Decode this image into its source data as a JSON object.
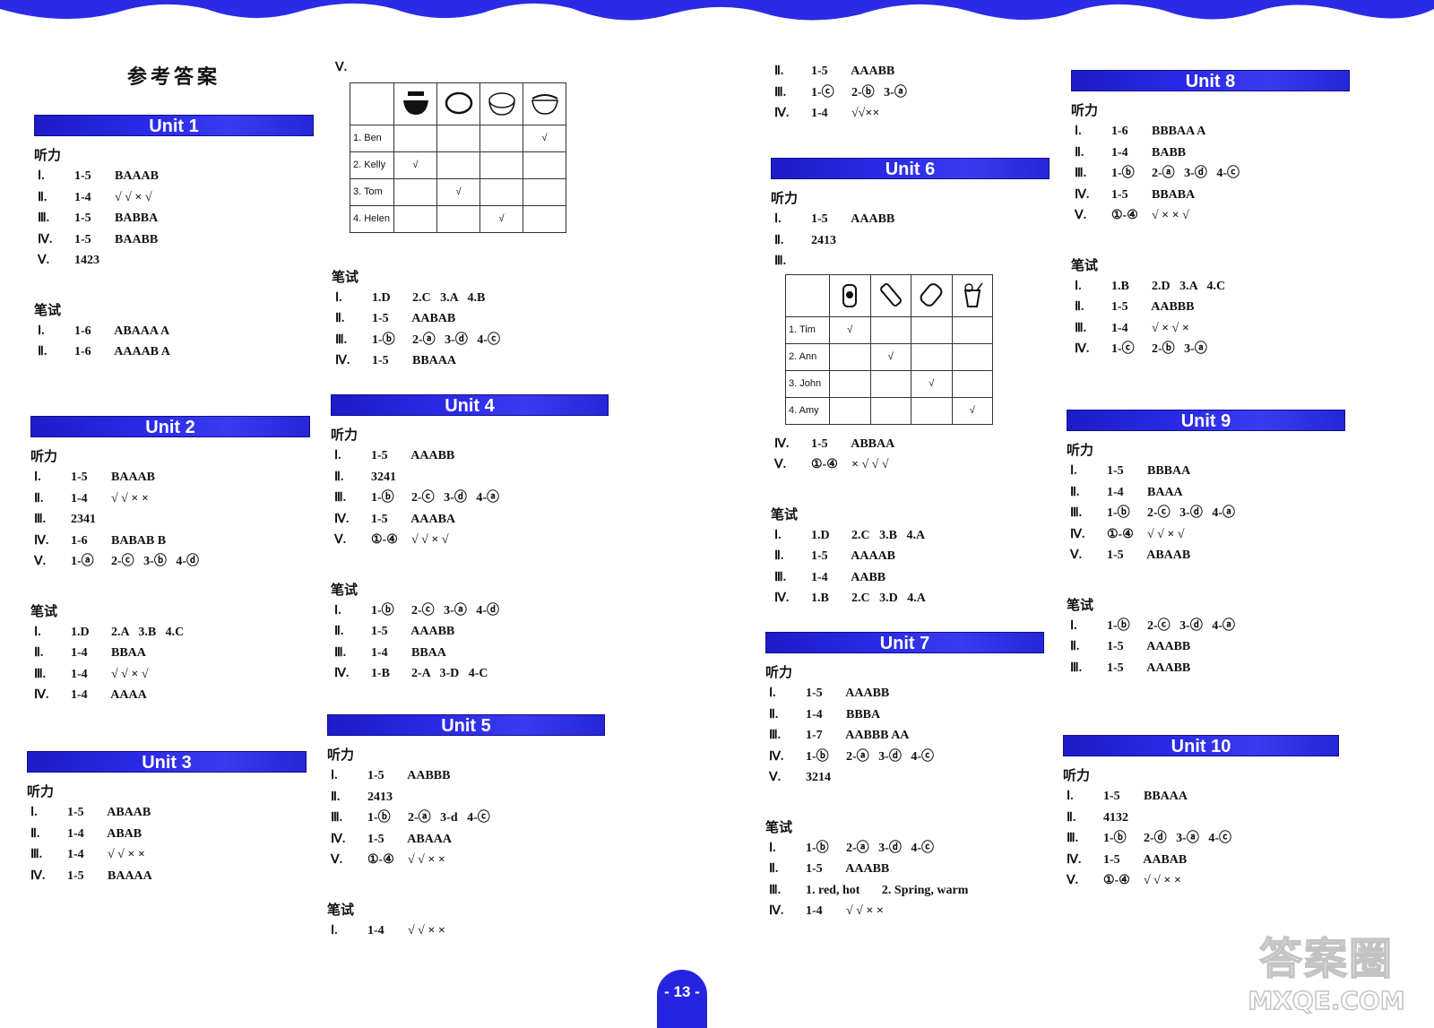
{
  "header": {
    "banner_color": "#2a2ae6"
  },
  "title": "参考答案",
  "labels": {
    "listening": "听力",
    "writing": "笔试"
  },
  "page_number": "- 13 -",
  "watermark": {
    "line1": "答案圈",
    "line2": "MXQE.COM"
  },
  "units": {
    "u1": {
      "name": "Unit 1",
      "listening": [
        {
          "num": "Ⅰ.",
          "range": "1-5",
          "ans": "BAAAB"
        },
        {
          "num": "Ⅱ.",
          "range": "1-4",
          "ans": "√ √ × √"
        },
        {
          "num": "Ⅲ.",
          "range": "1-5",
          "ans": "BABBA"
        },
        {
          "num": "Ⅳ.",
          "range": "1-5",
          "ans": "BAABB"
        },
        {
          "num": "Ⅴ.",
          "range": "1423",
          "ans": ""
        }
      ],
      "writing": [
        {
          "num": "Ⅰ.",
          "range": "1-6",
          "ans": "ABAAA A"
        },
        {
          "num": "Ⅱ.",
          "range": "1-6",
          "ans": "AAAAB A"
        }
      ]
    },
    "u1_cont": {
      "num": "Ⅴ.",
      "table": {
        "food_icons": [
          "noodles-bowl-icon",
          "plate-icon",
          "rice-bowl-icon",
          "soup-bowl-icon"
        ],
        "rows": [
          {
            "label": "1. Ben",
            "checks": [
              "",
              "",
              "",
              "√"
            ]
          },
          {
            "label": "2. Kelly",
            "checks": [
              "√",
              "",
              "",
              ""
            ]
          },
          {
            "label": "3. Tom",
            "checks": [
              "",
              "√",
              "",
              ""
            ]
          },
          {
            "label": "4. Helen",
            "checks": [
              "",
              "",
              "√",
              ""
            ]
          }
        ]
      },
      "writing": [
        {
          "num": "Ⅰ.",
          "range": "1.D",
          "ans": "2.C   3.A   4.B"
        },
        {
          "num": "Ⅱ.",
          "range": "1-5",
          "ans": "AABAB"
        },
        {
          "num": "Ⅲ.",
          "range": "1-ⓑ",
          "ans": "2-ⓐ   3-ⓓ   4-ⓒ"
        },
        {
          "num": "Ⅳ.",
          "range": "1-5",
          "ans": "BBAAA"
        }
      ]
    },
    "u2": {
      "name": "Unit 2",
      "listening": [
        {
          "num": "Ⅰ.",
          "range": "1-5",
          "ans": "BAAAB"
        },
        {
          "num": "Ⅱ.",
          "range": "1-4",
          "ans": "√ √ × ×"
        },
        {
          "num": "Ⅲ.",
          "range": "2341",
          "ans": ""
        },
        {
          "num": "Ⅳ.",
          "range": "1-6",
          "ans": "BABAB B"
        },
        {
          "num": "Ⅴ.",
          "range": "1-ⓐ",
          "ans": "2-ⓒ   3-ⓑ   4-ⓓ"
        }
      ],
      "writing": [
        {
          "num": "Ⅰ.",
          "range": "1.D",
          "ans": "2.A   3.B   4.C"
        },
        {
          "num": "Ⅱ.",
          "range": "1-4",
          "ans": "BBAA"
        },
        {
          "num": "Ⅲ.",
          "range": "1-4",
          "ans": "√ √ × √"
        },
        {
          "num": "Ⅳ.",
          "range": "1-4",
          "ans": "AAAA"
        }
      ]
    },
    "u3": {
      "name": "Unit 3",
      "listening": [
        {
          "num": "Ⅰ.",
          "range": "1-5",
          "ans": "ABAAB"
        },
        {
          "num": "Ⅱ.",
          "range": "1-4",
          "ans": "ABAB"
        },
        {
          "num": "Ⅲ.",
          "range": "1-4",
          "ans": "√ √ × ×"
        },
        {
          "num": "Ⅳ.",
          "range": "1-5",
          "ans": "BAAAA"
        }
      ]
    },
    "u4": {
      "name": "Unit 4",
      "listening": [
        {
          "num": "Ⅰ.",
          "range": "1-5",
          "ans": "AAABB"
        },
        {
          "num": "Ⅱ.",
          "range": "3241",
          "ans": ""
        },
        {
          "num": "Ⅲ.",
          "range": "1-ⓑ",
          "ans": "2-ⓒ   3-ⓓ   4-ⓐ"
        },
        {
          "num": "Ⅳ.",
          "range": "1-5",
          "ans": "AAABA"
        },
        {
          "num": "Ⅴ.",
          "range": "①-④",
          "ans": "√ √ × √"
        }
      ],
      "writing": [
        {
          "num": "Ⅰ.",
          "range": "1-ⓑ",
          "ans": "2-ⓒ   3-ⓐ   4-ⓓ"
        },
        {
          "num": "Ⅱ.",
          "range": "1-5",
          "ans": "AAABB"
        },
        {
          "num": "Ⅲ.",
          "range": "1-4",
          "ans": "BBAA"
        },
        {
          "num": "Ⅳ.",
          "range": "1-B",
          "ans": "2-A   3-D   4-C"
        }
      ]
    },
    "u5": {
      "name": "Unit 5",
      "listening": [
        {
          "num": "Ⅰ.",
          "range": "1-5",
          "ans": "AABBB"
        },
        {
          "num": "Ⅱ.",
          "range": "2413",
          "ans": ""
        },
        {
          "num": "Ⅲ.",
          "range": "1-ⓑ",
          "ans": "2-ⓐ   3-d   4-ⓒ"
        },
        {
          "num": "Ⅳ.",
          "range": "1-5",
          "ans": "ABAAA"
        },
        {
          "num": "Ⅴ.",
          "range": "①-④",
          "ans": "√ √ × ×"
        }
      ],
      "writing": [
        {
          "num": "Ⅰ.",
          "range": "1-4",
          "ans": "√ √ × ×"
        }
      ]
    },
    "u5_cont": {
      "writing": [
        {
          "num": "Ⅱ.",
          "range": "1-5",
          "ans": "AAABB"
        },
        {
          "num": "Ⅲ.",
          "range": "1-ⓒ",
          "ans": "2-ⓑ   3-ⓐ"
        },
        {
          "num": "Ⅳ.",
          "range": "1-4",
          "ans": "√√××"
        }
      ]
    },
    "u6": {
      "name": "Unit 6",
      "listening": [
        {
          "num": "Ⅰ.",
          "range": "1-5",
          "ans": "AAABB"
        },
        {
          "num": "Ⅱ.",
          "range": "2413",
          "ans": ""
        },
        {
          "num": "Ⅲ.",
          "range": "",
          "ans": ""
        }
      ],
      "table": {
        "drink_icons": [
          "jar-icon",
          "bottle-icon",
          "can-icon",
          "juice-cup-icon"
        ],
        "rows": [
          {
            "label": "1. Tim",
            "checks": [
              "√",
              "",
              "",
              ""
            ]
          },
          {
            "label": "2. Ann",
            "checks": [
              "",
              "√",
              "",
              ""
            ]
          },
          {
            "label": "3. John",
            "checks": [
              "",
              "",
              "√",
              ""
            ]
          },
          {
            "label": "4. Amy",
            "checks": [
              "",
              "",
              "",
              "√"
            ]
          }
        ]
      },
      "listening_after": [
        {
          "num": "Ⅳ.",
          "range": "1-5",
          "ans": "ABBAA"
        },
        {
          "num": "Ⅴ.",
          "range": "①-④",
          "ans": "× √ √ √"
        }
      ],
      "writing": [
        {
          "num": "Ⅰ.",
          "range": "1.D",
          "ans": "2.C   3.B   4.A"
        },
        {
          "num": "Ⅱ.",
          "range": "1-5",
          "ans": "AAAAB"
        },
        {
          "num": "Ⅲ.",
          "range": "1-4",
          "ans": "AABB"
        },
        {
          "num": "Ⅳ.",
          "range": "1.B",
          "ans": "2.C   3.D   4.A"
        }
      ]
    },
    "u7": {
      "name": "Unit 7",
      "listening": [
        {
          "num": "Ⅰ.",
          "range": "1-5",
          "ans": "AAABB"
        },
        {
          "num": "Ⅱ.",
          "range": "1-4",
          "ans": "BBBA"
        },
        {
          "num": "Ⅲ.",
          "range": "1-7",
          "ans": "AABBB AA"
        },
        {
          "num": "Ⅳ.",
          "range": "1-ⓑ",
          "ans": "2-ⓐ   3-ⓓ   4-ⓒ"
        },
        {
          "num": "Ⅴ.",
          "range": "3214",
          "ans": ""
        }
      ],
      "writing": [
        {
          "num": "Ⅰ.",
          "range": "1-ⓑ",
          "ans": "2-ⓐ   3-ⓓ   4-ⓒ"
        },
        {
          "num": "Ⅱ.",
          "range": "1-5",
          "ans": "AAABB"
        },
        {
          "num": "Ⅲ.",
          "range": "1. red, hot",
          "ans": "     2. Spring, warm"
        },
        {
          "num": "Ⅳ.",
          "range": "1-4",
          "ans": "√ √ × ×"
        }
      ]
    },
    "u8": {
      "name": "Unit 8",
      "listening": [
        {
          "num": "Ⅰ.",
          "range": "1-6",
          "ans": "BBBAA A"
        },
        {
          "num": "Ⅱ.",
          "range": "1-4",
          "ans": "BABB"
        },
        {
          "num": "Ⅲ.",
          "range": "1-ⓑ",
          "ans": "2-ⓐ   3-ⓓ   4-ⓒ"
        },
        {
          "num": "Ⅳ.",
          "range": "1-5",
          "ans": "BBABA"
        },
        {
          "num": "Ⅴ.",
          "range": "①-④",
          "ans": "√ × × √"
        }
      ],
      "writing": [
        {
          "num": "Ⅰ.",
          "range": "1.B",
          "ans": "2.D   3.A   4.C"
        },
        {
          "num": "Ⅱ.",
          "range": "1-5",
          "ans": "AABBB"
        },
        {
          "num": "Ⅲ.",
          "range": "1-4",
          "ans": "√ × √ ×"
        },
        {
          "num": "Ⅳ.",
          "range": "1-ⓒ",
          "ans": "2-ⓑ   3-ⓐ"
        }
      ]
    },
    "u9": {
      "name": "Unit 9",
      "listening": [
        {
          "num": "Ⅰ.",
          "range": "1-5",
          "ans": "BBBAA"
        },
        {
          "num": "Ⅱ.",
          "range": "1-4",
          "ans": "BAAA"
        },
        {
          "num": "Ⅲ.",
          "range": "1-ⓑ",
          "ans": "2-ⓒ   3-ⓓ   4-ⓐ"
        },
        {
          "num": "Ⅳ.",
          "range": "①-④",
          "ans": "√ √ × √"
        },
        {
          "num": "Ⅴ.",
          "range": "1-5",
          "ans": "ABAAB"
        }
      ],
      "writing": [
        {
          "num": "Ⅰ.",
          "range": "1-ⓑ",
          "ans": "2-ⓒ   3-ⓓ   4-ⓐ"
        },
        {
          "num": "Ⅱ.",
          "range": "1-5",
          "ans": "AAABB"
        },
        {
          "num": "Ⅲ.",
          "range": "1-5",
          "ans": "AAABB"
        }
      ]
    },
    "u10": {
      "name": "Unit 10",
      "listening": [
        {
          "num": "Ⅰ.",
          "range": "1-5",
          "ans": "BBAAA"
        },
        {
          "num": "Ⅱ.",
          "range": "4132",
          "ans": ""
        },
        {
          "num": "Ⅲ.",
          "range": "1-ⓑ",
          "ans": "2-ⓓ   3-ⓐ   4-ⓒ"
        },
        {
          "num": "Ⅳ.",
          "range": "1-5",
          "ans": "AABAB"
        },
        {
          "num": "Ⅴ.",
          "range": "①-④",
          "ans": "√ √ × ×"
        }
      ]
    }
  }
}
